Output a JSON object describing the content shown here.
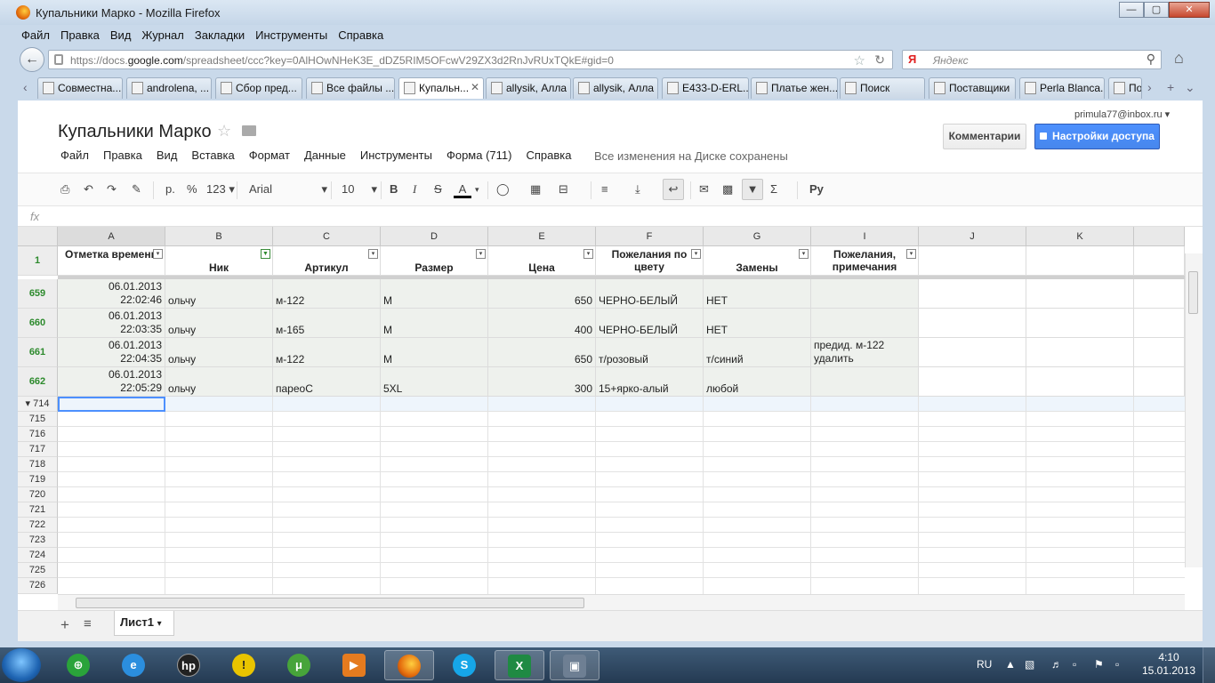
{
  "window": {
    "title": "Купальники Марко - Mozilla Firefox",
    "min": "—",
    "max": "▢",
    "close": "✕"
  },
  "menubar": [
    "Файл",
    "Правка",
    "Вид",
    "Журнал",
    "Закладки",
    "Инструменты",
    "Справка"
  ],
  "navbar": {
    "url_host_prefix": "https://docs.",
    "url_host": "google.com",
    "url_rest": "/spreadsheet/ccc?key=0AlHOwNHeK3E_dDZ5RIM5OFcwV29ZX3d2RnJvRUxTQkE#gid=0",
    "search_engine": "Я",
    "search_placeholder": "Яндекс"
  },
  "tabs": [
    {
      "label": "Совместна...",
      "active": false
    },
    {
      "label": "androlena, ...",
      "active": false
    },
    {
      "label": "Сбор пред...",
      "active": false
    },
    {
      "label": "Все файлы ...",
      "active": false
    },
    {
      "label": "Купальн...",
      "active": true
    },
    {
      "label": "allysik, Алла",
      "active": false
    },
    {
      "label": "allysik, Алла",
      "active": false
    },
    {
      "label": "E433-D-ERL...",
      "active": false
    },
    {
      "label": "Платье жен...",
      "active": false
    },
    {
      "label": "Поиск",
      "active": false
    },
    {
      "label": "Поставщики",
      "active": false
    },
    {
      "label": "Perla Blanca...",
      "active": false
    },
    {
      "label": "По",
      "active": false
    }
  ],
  "doc": {
    "title": "Купальники Марко",
    "user_email": "primula77@inbox.ru",
    "comments_label": "Комментарии",
    "share_label": "Настройки доступа",
    "save_status": "Все изменения на Диске сохранены"
  },
  "sheet_menu": [
    "Файл",
    "Правка",
    "Вид",
    "Вставка",
    "Формат",
    "Данные",
    "Инструменты",
    "Форма (711)",
    "Справка"
  ],
  "toolbar": {
    "currency": "р.",
    "percent": "%",
    "number_format": "123",
    "font": "Arial",
    "font_size": "10",
    "bold": "B",
    "italic": "I",
    "strike": "S",
    "text_color": "A",
    "input_tools": "Ру",
    "functions": "Σ"
  },
  "formula": {
    "fx": "fx"
  },
  "grid": {
    "columns": [
      "A",
      "B",
      "C",
      "D",
      "E",
      "F",
      "G",
      "I",
      "J",
      "K"
    ],
    "header_row_number": "1",
    "headers": [
      "Отметка времени",
      "Ник",
      "Артикул",
      "Размер",
      "Цена",
      "Пожелания по цвету",
      "Замены",
      "Пожелания, примечания"
    ],
    "rows": [
      {
        "num": "659",
        "date": "06.01.2013",
        "time": "22:02:46",
        "nick": "ольчу",
        "article": "м-122",
        "size": "M",
        "price": "650",
        "color": "ЧЕРНО-БЕЛЫЙ",
        "replace": "НЕТ",
        "note1": "",
        "note2": ""
      },
      {
        "num": "660",
        "date": "06.01.2013",
        "time": "22:03:35",
        "nick": "ольчу",
        "article": "м-165",
        "size": "M",
        "price": "400",
        "color": "ЧЕРНО-БЕЛЫЙ",
        "replace": "НЕТ",
        "note1": "",
        "note2": ""
      },
      {
        "num": "661",
        "date": "06.01.2013",
        "time": "22:04:35",
        "nick": "ольчу",
        "article": "м-122",
        "size": "M",
        "price": "650",
        "color": "т/розовый",
        "replace": "т/синий",
        "note1": "предид. м-122",
        "note2": "удалить"
      },
      {
        "num": "662",
        "date": "06.01.2013",
        "time": "22:05:29",
        "nick": "ольчу",
        "article": "парeoC",
        "size": "5XL",
        "price": "300",
        "color": "15+ярко-алый",
        "replace": "любой",
        "note1": "",
        "note2": ""
      }
    ],
    "empty_rows": [
      "714",
      "715",
      "716",
      "717",
      "718",
      "719",
      "720",
      "721",
      "722",
      "723",
      "724",
      "725",
      "726"
    ]
  },
  "sheetbar": {
    "add": "+",
    "list": "≡",
    "sheet_name": "Лист1"
  },
  "taskbar": {
    "lang": "RU",
    "time": "4:10",
    "date": "15.01.2013"
  }
}
